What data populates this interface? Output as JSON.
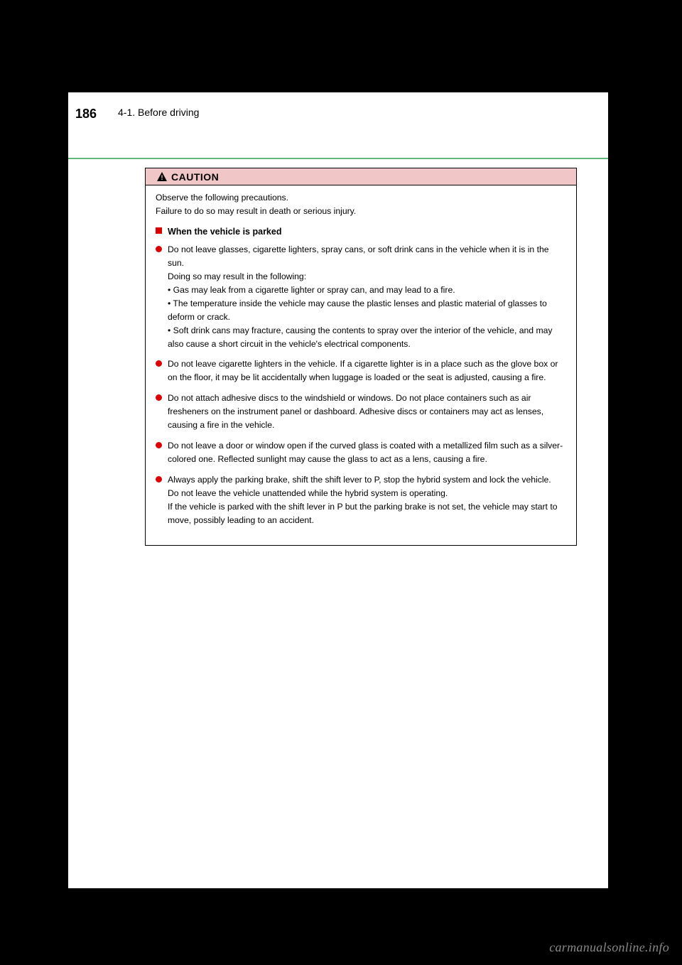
{
  "header": {
    "page_number": "186",
    "breadcrumb": "4-1. Before driving"
  },
  "caution": {
    "label": "CAUTION",
    "observe": "Observe the following precautions.\nFailure to do so may result in death or serious injury.",
    "section_heading": "When the vehicle is parked",
    "bullets": [
      "Do not leave glasses, cigarette lighters, spray cans, or soft drink cans in the vehicle when it is in the sun.\nDoing so may result in the following:\n• Gas may leak from a cigarette lighter or spray can, and may lead to a fire.\n• The temperature inside the vehicle may cause the plastic lenses and plastic material of glasses to deform or crack.\n• Soft drink cans may fracture, causing the contents to spray over the interior of the vehicle, and may also cause a short circuit in the vehicle's electrical components.",
      "Do not leave cigarette lighters in the vehicle. If a cigarette lighter is in a place such as the glove box or on the floor, it may be lit accidentally when luggage is loaded or the seat is adjusted, causing a fire.",
      "Do not attach adhesive discs to the windshield or windows. Do not place containers such as air fresheners on the instrument panel or dashboard. Adhesive discs or containers may act as lenses, causing a fire in the vehicle.",
      "Do not leave a door or window open if the curved glass is coated with a metallized film such as a silver-colored one. Reflected sunlight may cause the glass to act as a lens, causing a fire.",
      "Always apply the parking brake, shift the shift lever to P, stop the hybrid system and lock the vehicle.\nDo not leave the vehicle unattended while the hybrid system is operating.\nIf the vehicle is parked with the shift lever in P but the parking brake is not set, the vehicle may start to move, possibly leading to an accident."
    ]
  },
  "watermark": "carmanualsonline.info"
}
